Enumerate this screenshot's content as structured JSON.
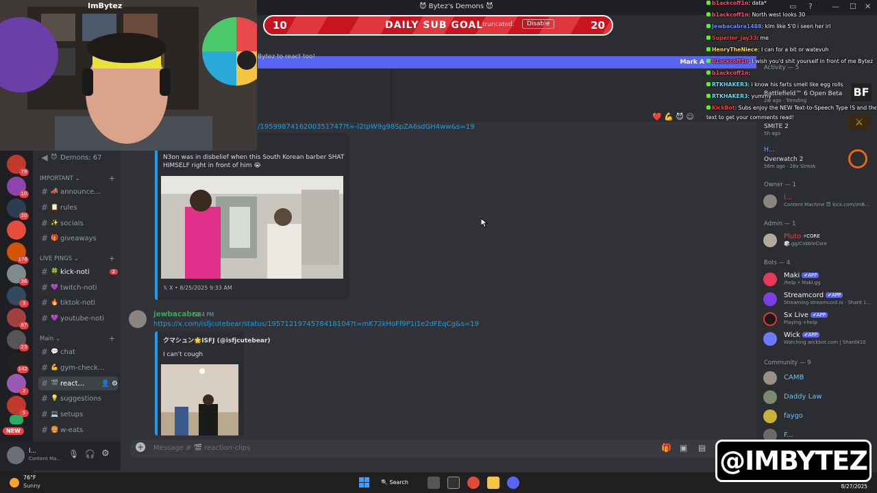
{
  "window": {
    "title": "Bytez's Demons"
  },
  "stream": {
    "sub_goal": {
      "current": "10",
      "label": "DAILY SUB GOAL",
      "target": "20",
      "truncated_text": "truncated.",
      "disable_label": "Disable"
    },
    "webcam_brand": "ImBytez",
    "chat": [
      {
        "user": "b1ackcoff1n",
        "text": ": data*",
        "color": "#ff4d6d"
      },
      {
        "user": "b1ackcoff1n",
        "text": ": North west looks 30",
        "color": "#ff4d6d"
      },
      {
        "user": "Jewbacabra1488",
        "text": ": klm like 5'0 i seen her irl",
        "color": "#6b8cff"
      },
      {
        "user": "Superior_jay33",
        "text": ": me",
        "color": "#ff3b3b"
      },
      {
        "user": "HenryTheNiece",
        "text": ": I can for a bit or watevuh",
        "color": "#ffd54a"
      },
      {
        "user": "b1ackcoff1n",
        "text": ": I wish you'd shit yourself in front of me Bytez",
        "color": "#ff4d6d"
      },
      {
        "user": "b1ackcoff1n",
        "text": ": ",
        "color": "#ff4d6d"
      },
      {
        "user": "RTKHAKER3",
        "text": ": i know his farts smell like egg rolls",
        "color": "#5be2ff"
      },
      {
        "user": "RTKHAKER3",
        "text": ": yummy",
        "color": "#5be2ff"
      },
      {
        "user": "KickBot",
        "text": ": Subs enjoy the NEW Text-to-Speech Type !S and then your",
        "color": "#ff3b3b"
      },
      {
        "user": "",
        "text": "text to get your comments read!",
        "color": "#ffffff"
      }
    ],
    "watermark": "@IMBYTEZ"
  },
  "servers": {
    "badges": [
      "79",
      "10",
      "20",
      "",
      "176",
      "36",
      "3",
      "67",
      "23",
      "142",
      "2",
      "5"
    ],
    "new_label": "NEW"
  },
  "channels": {
    "demons": "Demons: 67",
    "categories": {
      "important": "IMPORTANT",
      "live_pings": "LIVE PINGS",
      "main": "Main"
    },
    "important": [
      {
        "name": "announce...",
        "emoji": "📣"
      },
      {
        "name": "rules",
        "emoji": "📋"
      },
      {
        "name": "socials",
        "emoji": "✨"
      },
      {
        "name": "giveaways",
        "emoji": "🎁"
      }
    ],
    "live": [
      {
        "name": "kick-noti",
        "emoji": "🍀",
        "badge": "2"
      },
      {
        "name": "twitch-noti",
        "emoji": "💜"
      },
      {
        "name": "tiktok-noti",
        "emoji": "🔥"
      },
      {
        "name": "youtube-noti",
        "emoji": "💜"
      }
    ],
    "main": [
      {
        "name": "chat",
        "emoji": "💬"
      },
      {
        "name": "gym-check...",
        "emoji": "💪"
      },
      {
        "name": "react...",
        "emoji": "🎬"
      },
      {
        "name": "suggestions",
        "emoji": "💡"
      },
      {
        "name": "setups",
        "emoji": "💻"
      },
      {
        "name": "w-eats",
        "emoji": "🍔"
      }
    ]
  },
  "user_panel": {
    "name": "l...",
    "status": "Content Ma..."
  },
  "main": {
    "notice": "Bytez to react too!",
    "purple_bar_name": "Mark A",
    "msg1": {
      "link": "/1959987416200351747?t=-l2tpW9g98SpZA6sdGH4ww&s=19",
      "embed_text": "N3on was in disbelief when this South Korean barber SHAT HIMSELF right in front of him 😭",
      "embed_footer": "X • 8/25/2025 9:33 AM"
    },
    "msg2": {
      "author": "jewbacabra",
      "time": "5:34 PM",
      "link": "https://x.com/isfjcutebear/status/1957121974578418104?t=mK72kHoFf9P1i1e2dFEqCg&s=19",
      "embed_author": "クマシュン🌟ISFJ (@isfjcutebear)",
      "embed_text": "I can't cough"
    },
    "composer_placeholder": "Message # 🎬 reaction-clips"
  },
  "members": {
    "activity": "Activity — 5",
    "activities": [
      {
        "name": "Battlefield™ 6 Open Beta",
        "sub": "2w ago · Trending"
      },
      {
        "name": "SMITE 2",
        "sub": "5h ago"
      },
      {
        "name": "H...",
        "sub": ""
      },
      {
        "name": "Overwatch 2",
        "sub": "56m ago · 28x Streak"
      }
    ],
    "owner_cat": "Owner — 1",
    "owner": {
      "name": "l...",
      "status": "Content Machine 😈 kick.com/imB..."
    },
    "admin_cat": "Admin — 1",
    "admin": {
      "name": "Pluto",
      "tag": "⚡CORE",
      "status": "🎲.gg/CobbleCore"
    },
    "bots_cat": "Bots — 4",
    "bots": [
      {
        "name": "Maki",
        "tag": "✔APP",
        "status": "/help • Maki.gg"
      },
      {
        "name": "Streamcord",
        "tag": "✔APP",
        "status": "Streaming streamcord.io · Shard 1..."
      },
      {
        "name": "Sx Live",
        "tag": "✔APP",
        "status": "Playing +help"
      },
      {
        "name": "Wick",
        "tag": "✔APP",
        "status": "Watching wickbot.com | Shard410"
      }
    ],
    "community_cat": "Community — 9",
    "community": [
      "CAMB",
      "Daddy Law",
      "faygo",
      "F..."
    ]
  },
  "taskbar": {
    "temp": "76°F",
    "weather": "Sunny",
    "search": "Search",
    "date": "8/27/2025"
  },
  "colors": {
    "accent": "#5865f2",
    "link": "#00a8fc",
    "author": "#3ba55c",
    "twitter": "#1d9bf0"
  }
}
